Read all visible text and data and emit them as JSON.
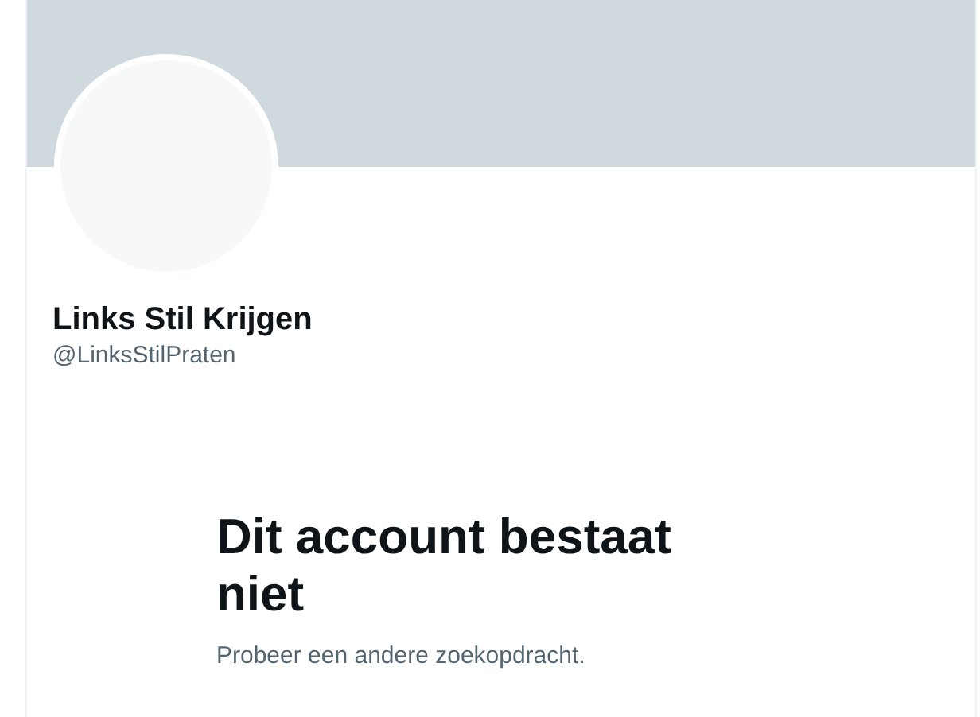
{
  "profile": {
    "banner": {
      "kind": "banner"
    },
    "name": "Links Stil Krijgen",
    "handle": "@LinksStilPraten"
  },
  "empty_state": {
    "title": "Dit account bestaat niet",
    "message": "Probeer een andere zoekopdracht."
  }
}
